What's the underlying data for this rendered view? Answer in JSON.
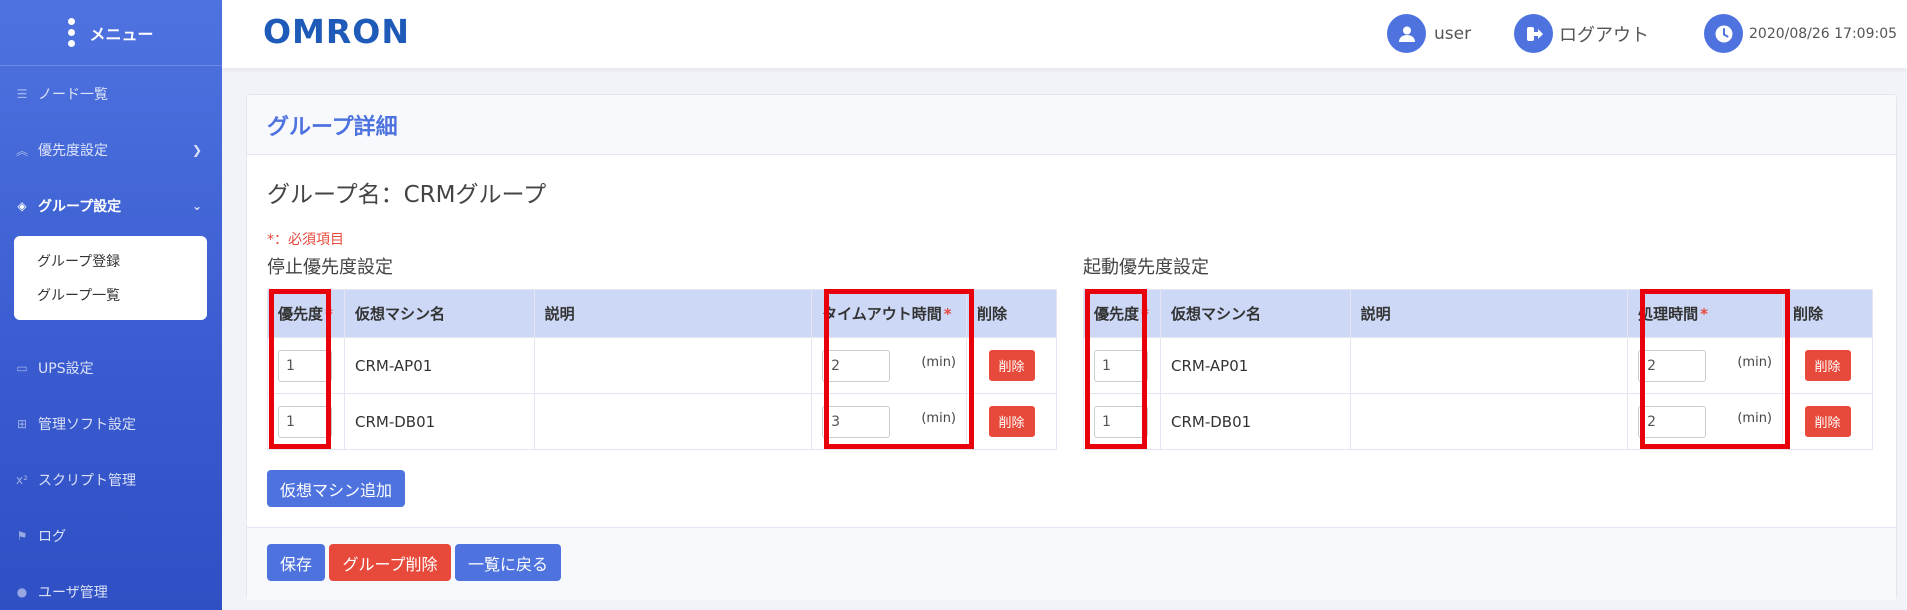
{
  "sidebar": {
    "menu_title": "メニュー",
    "items": [
      {
        "label": "ノード一覧",
        "icon": "list-icon"
      },
      {
        "label": "優先度設定",
        "icon": "chevrons-up-icon"
      },
      {
        "label": "グループ設定",
        "icon": "layers-icon"
      },
      {
        "label": "UPS設定",
        "icon": "battery-icon"
      },
      {
        "label": "管理ソフト設定",
        "icon": "sitemap-icon"
      },
      {
        "label": "スクリプト管理",
        "icon": "superscript-icon"
      },
      {
        "label": "ログ",
        "icon": "flag-icon"
      },
      {
        "label": "ユーザ管理",
        "icon": "user-icon"
      }
    ],
    "submenu": [
      "グループ登録",
      "グループ一覧"
    ]
  },
  "header": {
    "logo": "OMRON",
    "user": "user",
    "logout": "ログアウト",
    "datetime": "2020/08/26 17:09:05"
  },
  "card": {
    "title": "グループ詳細",
    "group_name": "グループ名：CRMグループ",
    "required_note": "*：必須項目",
    "stop_section": {
      "title": "停止優先度設定",
      "headers": [
        "優先度",
        "仮想マシン名",
        "説明",
        "タイムアウト時間",
        "削除"
      ],
      "rows": [
        {
          "priority": "1",
          "vm": "CRM-AP01",
          "desc": "",
          "time": "2",
          "unit": "(min)",
          "delete": "削除"
        },
        {
          "priority": "1",
          "vm": "CRM-DB01",
          "desc": "",
          "time": "3",
          "unit": "(min)",
          "delete": "削除"
        }
      ]
    },
    "start_section": {
      "title": "起動優先度設定",
      "headers": [
        "優先度",
        "仮想マシン名",
        "説明",
        "処理時間",
        "削除"
      ],
      "rows": [
        {
          "priority": "1",
          "vm": "CRM-AP01",
          "desc": "",
          "time": "2",
          "unit": "(min)",
          "delete": "削除"
        },
        {
          "priority": "1",
          "vm": "CRM-DB01",
          "desc": "",
          "time": "2",
          "unit": "(min)",
          "delete": "削除"
        }
      ]
    },
    "star": "*",
    "add_vm": "仮想マシン追加",
    "save": "保存",
    "delete_group": "グループ削除",
    "back": "一覧に戻る"
  },
  "colors": {
    "primary": "#4e73df",
    "danger": "#e74a3b",
    "highlight": "#e8000b",
    "logo": "#1e5bb8"
  }
}
